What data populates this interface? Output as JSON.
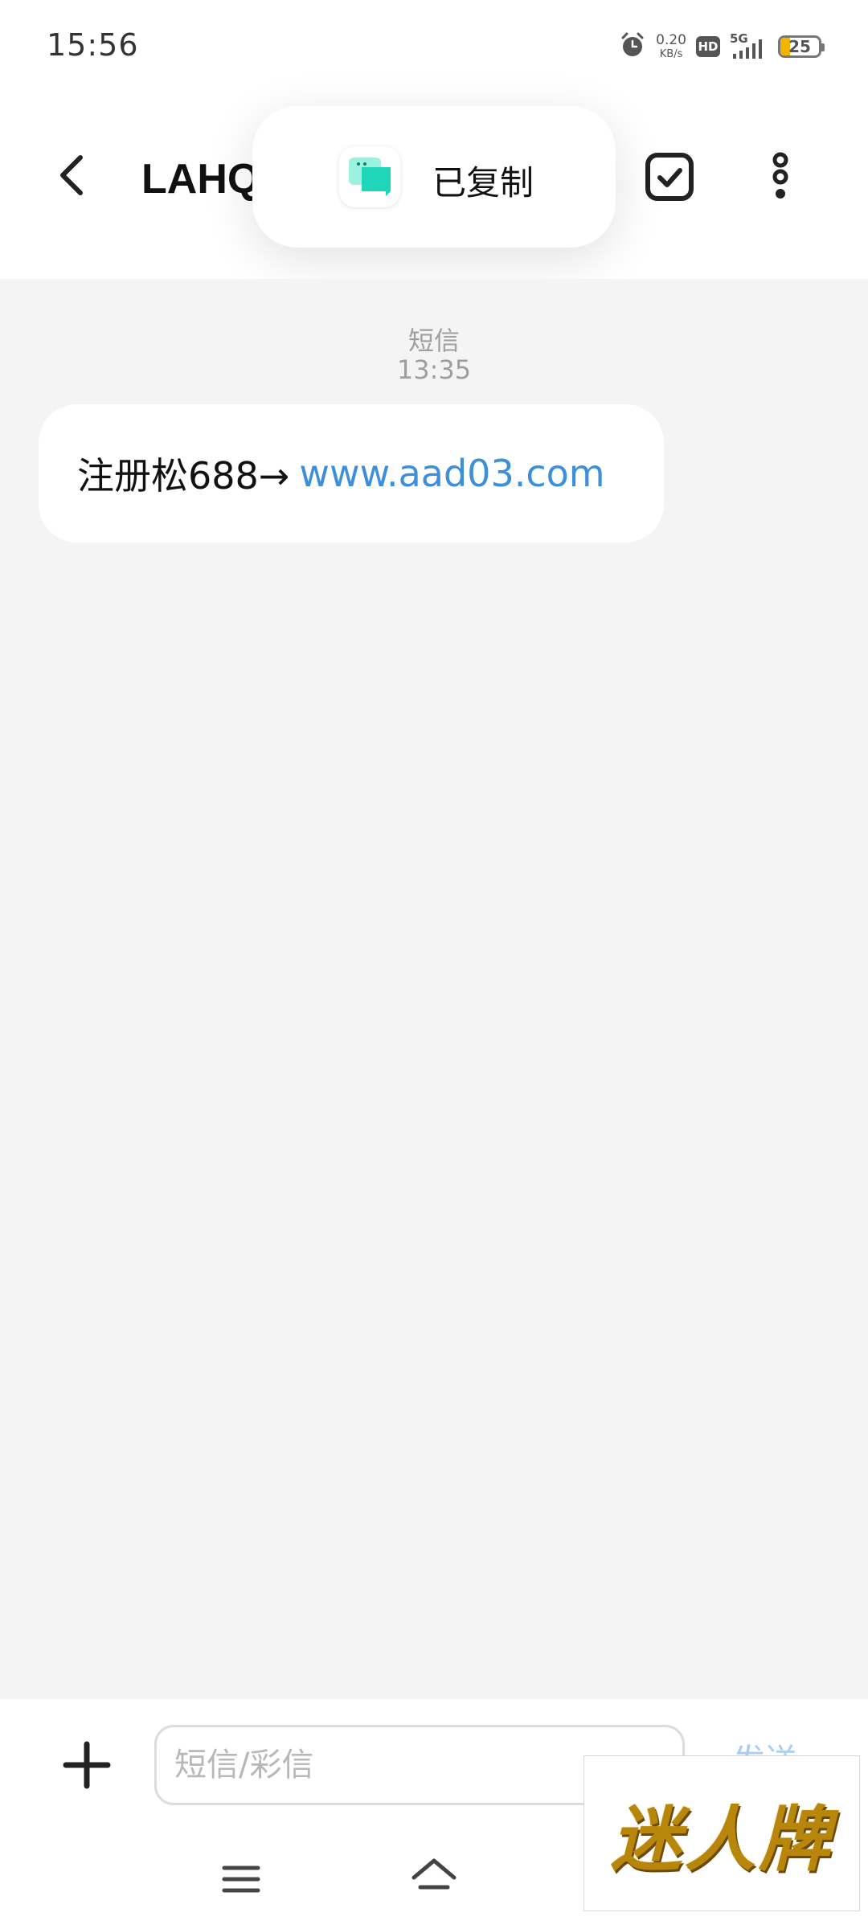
{
  "status_bar": {
    "time": "15:56",
    "net_speed_value": "0.20",
    "net_speed_unit": "KB/s",
    "hd_label": "HD",
    "network_label": "5G",
    "battery_level": "25",
    "icons": [
      "alarm-icon",
      "hd-icon",
      "signal-5g-icon",
      "battery-icon"
    ]
  },
  "header": {
    "title": "LAHQ",
    "icons": [
      "back-arrow-icon",
      "checkbox-select-icon",
      "more-vertical-icon"
    ]
  },
  "toast": {
    "label": "已复制",
    "icon": "clipboard-chat-icon",
    "icon_colors": [
      "#9ef0df",
      "#1fd6b8"
    ]
  },
  "conversation": {
    "message_type": "短信",
    "timestamp": "13:35",
    "messages": [
      {
        "text": "注册松688→",
        "link": "www.aad03.com"
      }
    ]
  },
  "input_bar": {
    "placeholder": "短信/彩信",
    "send_label": "发送",
    "icons": [
      "plus-icon"
    ]
  },
  "nav_bar": {
    "icons": [
      "menu-icon",
      "home-icon"
    ]
  },
  "watermark": {
    "text": "迷人牌"
  },
  "colors": {
    "link": "#3d8fdc",
    "background": "#f4f4f4",
    "send_disabled": "#a8cdf0"
  }
}
